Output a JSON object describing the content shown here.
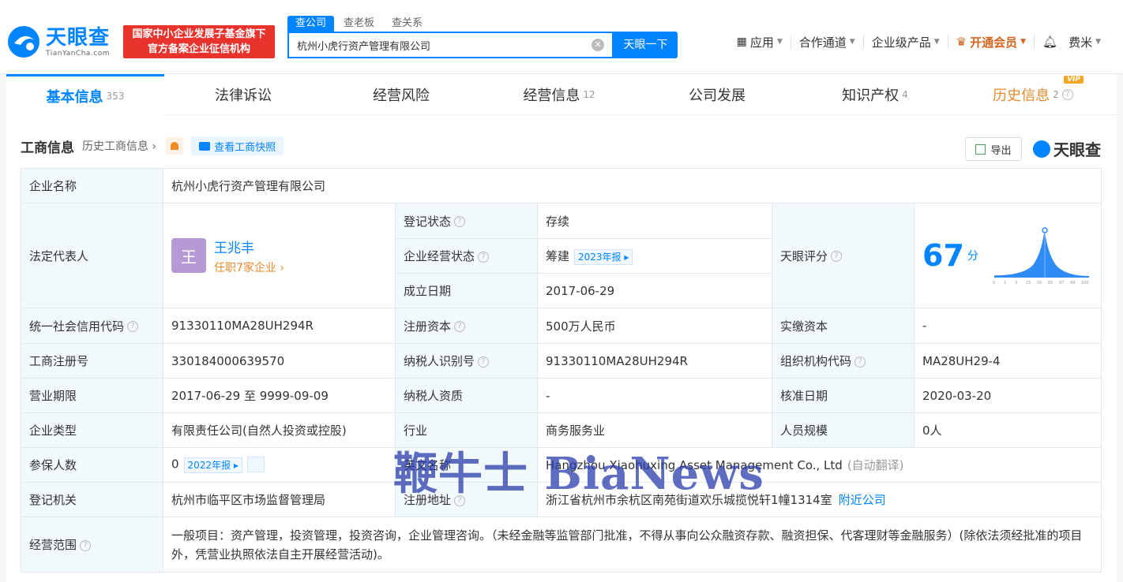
{
  "brand": {
    "name": "天眼查",
    "domain": "TianYanCha.com",
    "accent": "#0084ff"
  },
  "promo_badge": {
    "line1": "国家中小企业发展子基金旗下",
    "line2": "官方备案企业征信机构"
  },
  "search": {
    "tabs": [
      "查公司",
      "查老板",
      "查关系"
    ],
    "value": "杭州小虎行资产管理有限公司",
    "button": "天眼一下"
  },
  "topnav": {
    "apps": "应用",
    "partner": "合作通道",
    "enterprise": "企业级产品",
    "vip": "开通会员",
    "user": "费米"
  },
  "tabs": [
    {
      "label": "基本信息",
      "count": "353"
    },
    {
      "label": "法律诉讼",
      "count": ""
    },
    {
      "label": "经营风险",
      "count": ""
    },
    {
      "label": "经营信息",
      "count": "12"
    },
    {
      "label": "公司发展",
      "count": ""
    },
    {
      "label": "知识产权",
      "count": "4"
    },
    {
      "label": "历史信息",
      "count": "2",
      "vip": "VIP"
    }
  ],
  "section": {
    "title": "工商信息",
    "history_link": "历史工商信息",
    "snapshot": "查看工商快照",
    "export": "导出",
    "brand": "天眼查"
  },
  "info": {
    "company_name_label": "企业名称",
    "company_name": "杭州小虎行资产管理有限公司",
    "legal_rep_label": "法定代表人",
    "legal_rep_avatar": "王",
    "legal_rep_name": "王兆丰",
    "legal_rep_sub": "任职7家企业",
    "reg_status_label": "登记状态",
    "reg_status": "存续",
    "op_status_label": "企业经营状态",
    "op_status": "筹建",
    "op_report": "2023年报",
    "founded_label": "成立日期",
    "founded": "2017-06-29",
    "score_label": "天眼评分",
    "score": "67",
    "score_unit": "分",
    "credit_code_label": "统一社会信用代码",
    "credit_code": "91330110MA28UH294R",
    "reg_capital_label": "注册资本",
    "reg_capital": "500万人民币",
    "paid_capital_label": "实缴资本",
    "paid_capital": "-",
    "reg_no_label": "工商注册号",
    "reg_no": "330184000639570",
    "taxpayer_id_label": "纳税人识别号",
    "taxpayer_id": "91330110MA28UH294R",
    "org_code_label": "组织机构代码",
    "org_code": "MA28UH29-4",
    "term_label": "营业期限",
    "term": "2017-06-29 至 9999-09-09",
    "tax_qual_label": "纳税人资质",
    "tax_qual": "-",
    "approve_date_label": "核准日期",
    "approve_date": "2020-03-20",
    "type_label": "企业类型",
    "type": "有限责任公司(自然人投资或控股)",
    "industry_label": "行业",
    "industry": "商务服务业",
    "staff_label": "人员规模",
    "staff": "0人",
    "insured_label": "参保人数",
    "insured": "0",
    "insured_report": "2022年报",
    "en_name_label": "英文名称",
    "en_name": "Hangzhou Xiaohuxing Asset Management Co., Ltd",
    "en_name_note": "(自动翻译)",
    "authority_label": "登记机关",
    "authority": "杭州市临平区市场监督管理局",
    "address_label": "注册地址",
    "address": "浙江省杭州市余杭区南苑街道欢乐城揽悦轩1幢1314室",
    "nearby": "附近公司",
    "scope_label": "经营范围",
    "scope": "一般项目：资产管理，投资管理，投资咨询，企业管理咨询。（未经金融等监管部门批准，不得从事向公众融资存款、融资担保、代客理财等金融服务）(除依法须经批准的项目外，凭营业执照依法自主开展经营活动)。"
  },
  "score_axis": [
    "0",
    "1",
    "3",
    "15",
    "50",
    "85",
    "97",
    "99",
    "100"
  ],
  "watermark": "鞭牛士 BiaNews"
}
